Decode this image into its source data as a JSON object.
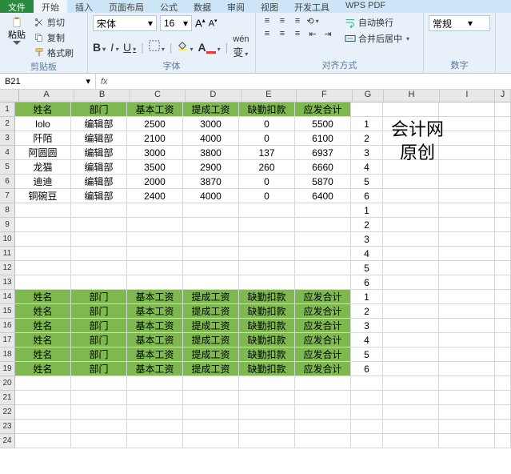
{
  "tabs": [
    "文件",
    "开始",
    "插入",
    "页面布局",
    "公式",
    "数据",
    "审阅",
    "视图",
    "开发工具",
    "WPS PDF"
  ],
  "clipboard": {
    "title": "剪贴板",
    "paste": "粘贴",
    "cut": "剪切",
    "copy": "复制",
    "format": "格式刷"
  },
  "font": {
    "title": "字体",
    "name": "宋体",
    "size": "16"
  },
  "align": {
    "title": "对齐方式",
    "wrap": "自动换行",
    "merge": "合并后居中"
  },
  "number": {
    "title": "数字",
    "format": "常规"
  },
  "namebox": "B21",
  "cols": [
    "A",
    "B",
    "C",
    "D",
    "E",
    "F",
    "G",
    "H",
    "I",
    "J"
  ],
  "header": [
    "姓名",
    "部门",
    "基本工资",
    "提成工资",
    "缺勤扣款",
    "应发合计"
  ],
  "rows": [
    {
      "a": "lolo",
      "b": "编辑部",
      "c": "2500",
      "d": "3000",
      "e": "0",
      "f": "5500",
      "g": "1"
    },
    {
      "a": "阡陌",
      "b": "编辑部",
      "c": "2100",
      "d": "4000",
      "e": "0",
      "f": "6100",
      "g": "2"
    },
    {
      "a": "阿圆圆",
      "b": "编辑部",
      "c": "3000",
      "d": "3800",
      "e": "137",
      "f": "6937",
      "g": "3"
    },
    {
      "a": "龙猫",
      "b": "编辑部",
      "c": "3500",
      "d": "2900",
      "e": "260",
      "f": "6660",
      "g": "4"
    },
    {
      "a": "迪迪",
      "b": "编辑部",
      "c": "2000",
      "d": "3870",
      "e": "0",
      "f": "5870",
      "g": "5"
    },
    {
      "a": "铜碗豆",
      "b": "编辑部",
      "c": "2400",
      "d": "4000",
      "e": "0",
      "f": "6400",
      "g": "6"
    }
  ],
  "gnums": [
    "1",
    "2",
    "3",
    "4",
    "5",
    "6"
  ],
  "watermark": {
    "l1": "会计网",
    "l2": "原创"
  }
}
